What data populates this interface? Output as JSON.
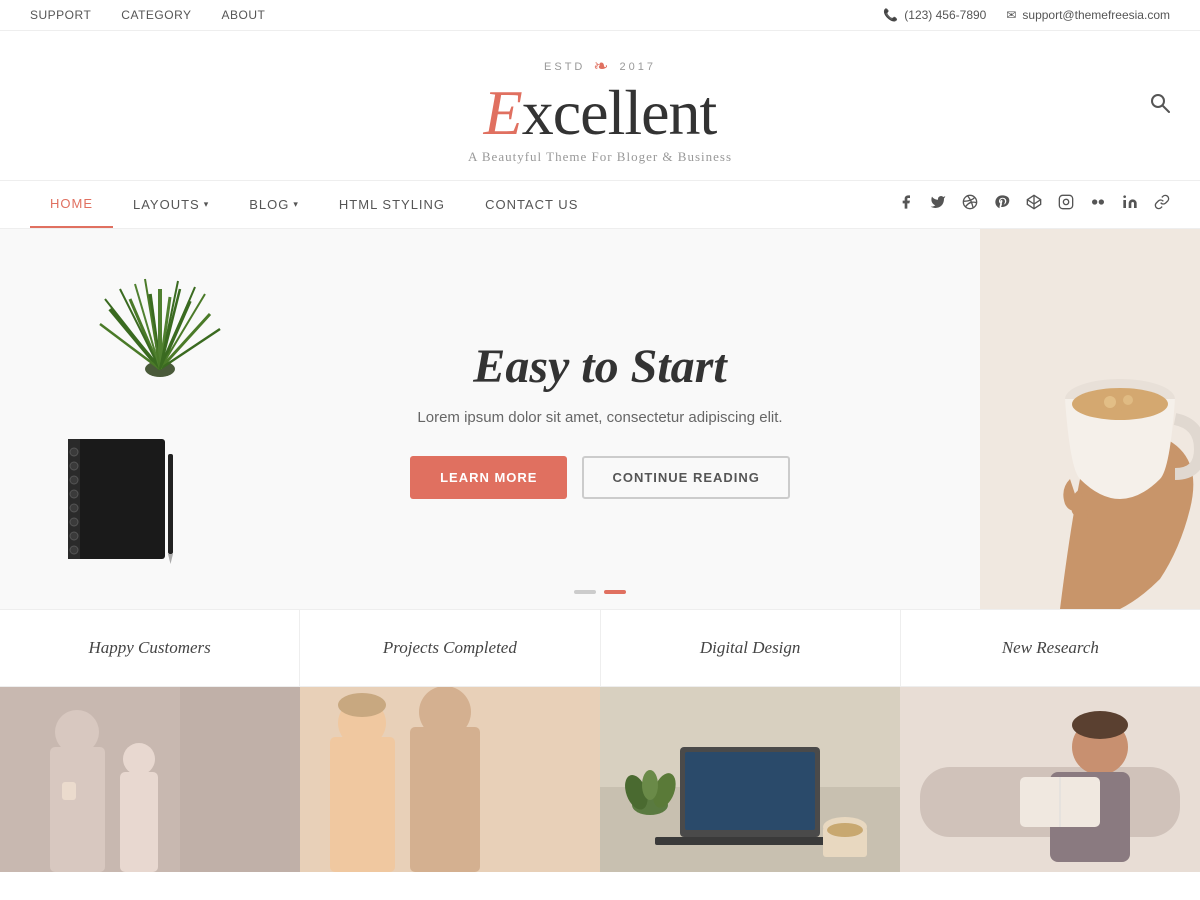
{
  "topbar": {
    "left_links": [
      {
        "label": "SUPPORT",
        "href": "#"
      },
      {
        "label": "CATEGORY",
        "href": "#"
      },
      {
        "label": "ABOUT",
        "href": "#"
      }
    ],
    "phone_icon": "📞",
    "phone": "(123) 456-7890",
    "email_icon": "✉",
    "email": "support@themefreesia.com"
  },
  "logo": {
    "estd_label": "ESTD",
    "year": "2017",
    "flower": "❧",
    "brand": "Excellent",
    "brand_first": "E",
    "brand_rest": "xcellent",
    "tagline": "A Beautyful Theme For Bloger & Business"
  },
  "main_nav": {
    "links": [
      {
        "label": "HOME",
        "active": true
      },
      {
        "label": "LAYOUTS",
        "has_dropdown": true
      },
      {
        "label": "BLOG",
        "has_dropdown": true
      },
      {
        "label": "HTML STYLING",
        "has_dropdown": false
      },
      {
        "label": "CONTACT US",
        "has_dropdown": false
      }
    ],
    "social_links": [
      {
        "name": "facebook",
        "icon": "f"
      },
      {
        "name": "twitter",
        "icon": "t"
      },
      {
        "name": "dribbble",
        "icon": "d"
      },
      {
        "name": "pinterest",
        "icon": "p"
      },
      {
        "name": "codepen",
        "icon": "c"
      },
      {
        "name": "instagram",
        "icon": "i"
      },
      {
        "name": "flickr",
        "icon": "fl"
      },
      {
        "name": "linkedin",
        "icon": "in"
      },
      {
        "name": "link",
        "icon": "🔗"
      }
    ]
  },
  "hero": {
    "title": "Easy to Start",
    "description": "Lorem ipsum dolor sit amet, consectetur adipiscing elit.",
    "btn_learn": "LEARN MORE",
    "btn_continue": "CONTINUE READING",
    "dots": [
      {
        "active": false
      },
      {
        "active": true
      }
    ]
  },
  "stats": [
    {
      "label": "Happy Customers"
    },
    {
      "label": "Projects Completed"
    },
    {
      "label": "Digital Design"
    },
    {
      "label": "New Research"
    }
  ],
  "photos": [
    {
      "alt": "mother and daughter"
    },
    {
      "alt": "couple smiling"
    },
    {
      "alt": "laptop and succulent"
    },
    {
      "alt": "person reading"
    }
  ]
}
